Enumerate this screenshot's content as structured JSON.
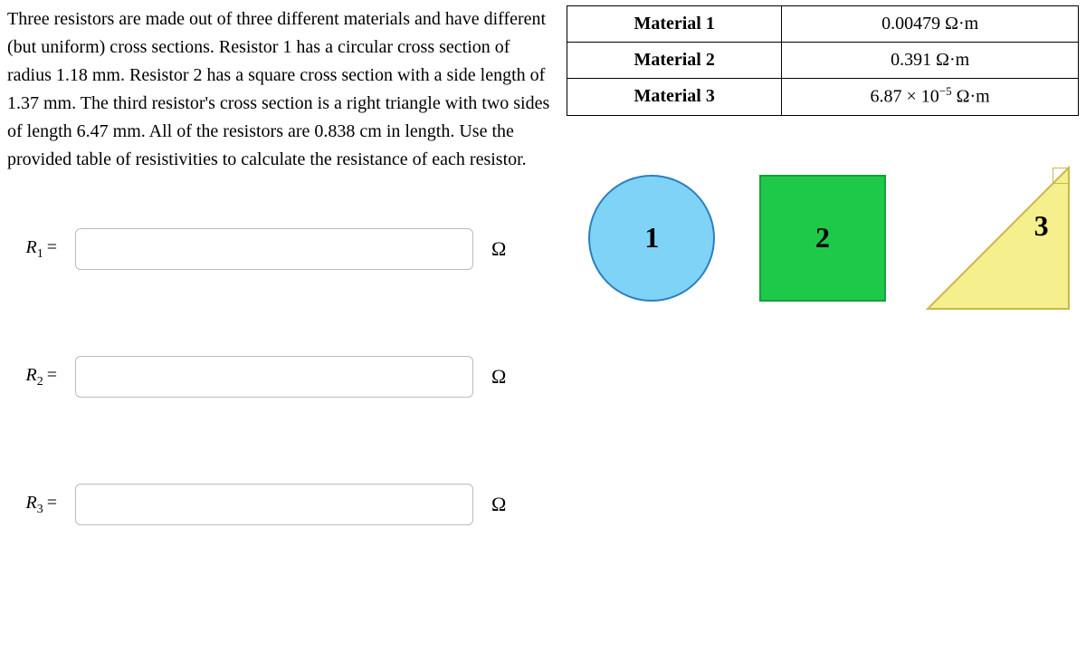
{
  "problem_text": "Three resistors are made out of three different materials and have different (but uniform) cross sections. Resistor 1 has a circular cross section of radius 1.18 mm. Resistor 2 has a square cross section with a side length of 1.37 mm. The third resistor's cross section is a right triangle with two sides of length 6.47 mm. All of the resistors are 0.838 cm in length. Use the provided table of resistivities to calculate the resistance of each resistor.",
  "table": {
    "rows": [
      {
        "material": "Material 1",
        "value": "0.00479 Ω·m"
      },
      {
        "material": "Material 2",
        "value": "0.391 Ω·m"
      },
      {
        "material": "Material 3",
        "value_html": "6.87 × 10⁻⁵ Ω·m"
      }
    ]
  },
  "shapes": {
    "circle_label": "1",
    "square_label": "2",
    "triangle_label": "3"
  },
  "answers": [
    {
      "label_var": "R",
      "label_sub": "1",
      "unit": "Ω"
    },
    {
      "label_var": "R",
      "label_sub": "2",
      "unit": "Ω"
    },
    {
      "label_var": "R",
      "label_sub": "3",
      "unit": "Ω"
    }
  ],
  "equals": "="
}
